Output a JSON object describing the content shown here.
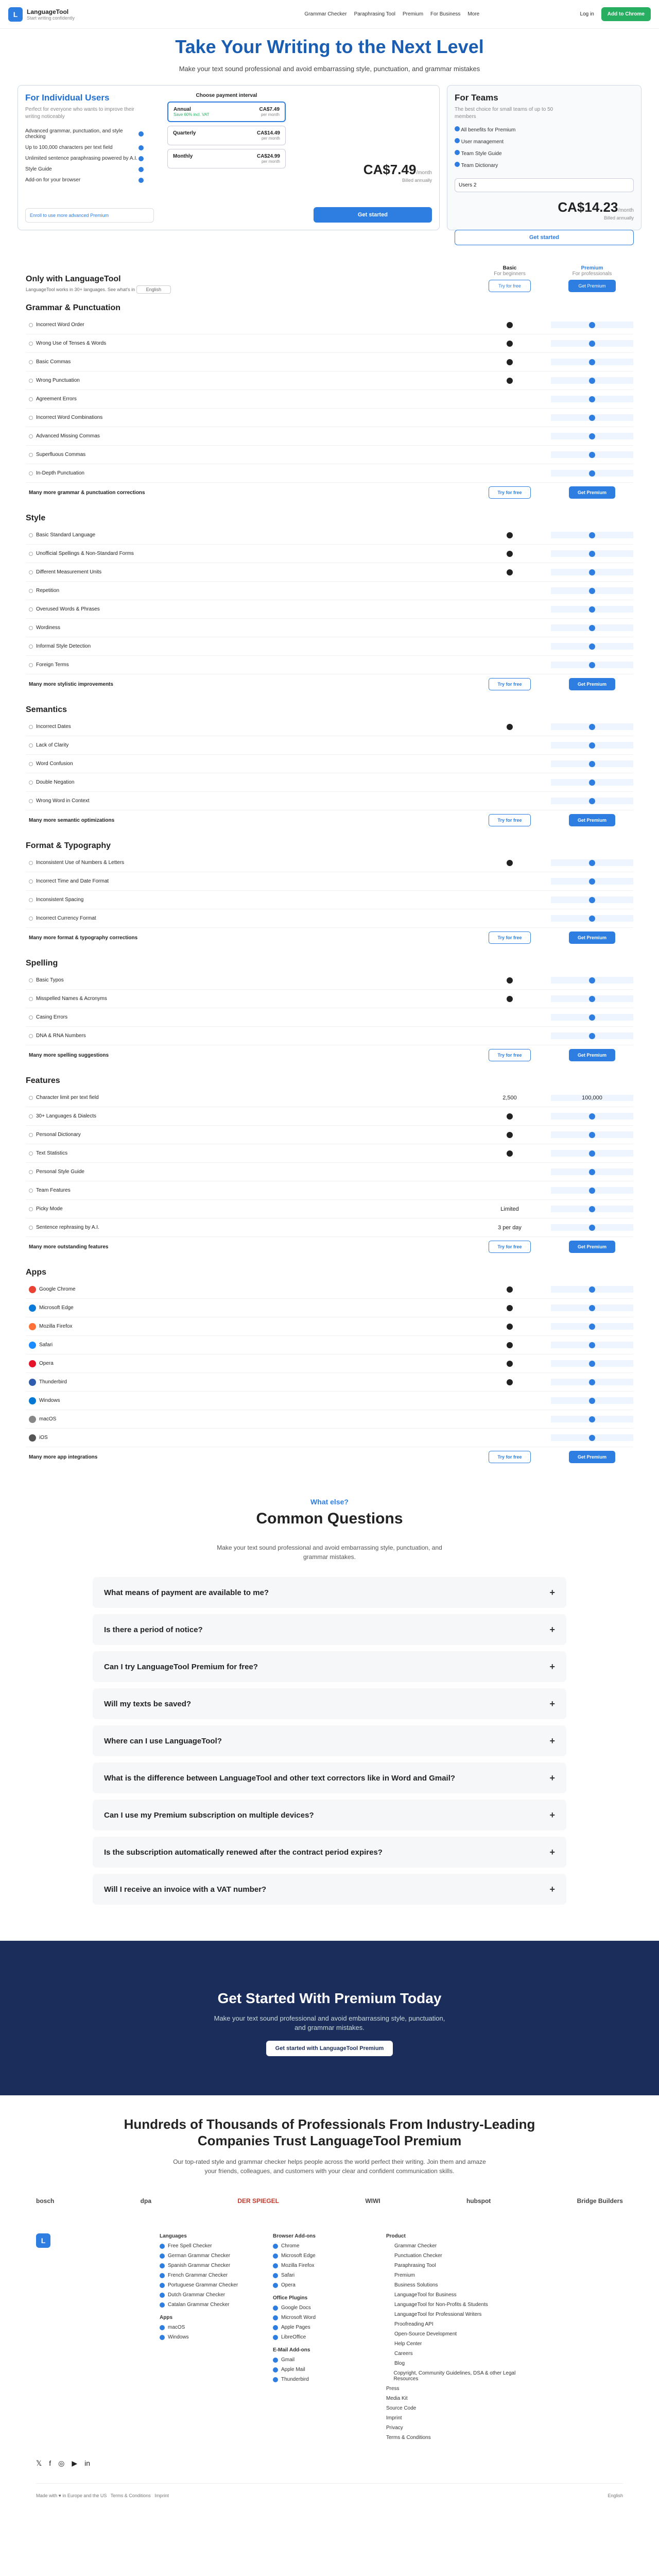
{
  "nav": {
    "brand": "LanguageTool",
    "tagline": "Start writing confidently",
    "links": [
      "Grammar Checker",
      "Paraphrasing Tool",
      "Premium",
      "For Business",
      "More"
    ],
    "login": "Log in",
    "cta": "Add to Chrome"
  },
  "hero": {
    "title": "Take Your Writing to the Next Level",
    "subtitle": "Make your text sound professional and avoid embarrassing style, punctuation, and grammar mistakes"
  },
  "individual": {
    "title": "For Individual Users",
    "desc": "Perfect for everyone who wants to improve their writing noticeably",
    "features": [
      "Advanced grammar, punctuation, and style checking",
      "Up to 100,000 characters per text field",
      "Unlimited sentence paraphrasing powered by A.I.",
      "Style Guide",
      "Add-on for your browser"
    ],
    "pay_head": "Choose payment interval",
    "options": [
      {
        "name": "Annual",
        "note": "Save 60% incl. VAT",
        "price": "CA$7.49",
        "unit": "per month"
      },
      {
        "name": "Quarterly",
        "note": "",
        "price": "CA$14.49",
        "unit": "per month"
      },
      {
        "name": "Monthly",
        "note": "",
        "price": "CA$24.99",
        "unit": "per month"
      }
    ],
    "price": "CA$7.49",
    "per": "/month",
    "billed": "Billed annually",
    "trial": "Enroll to use more advanced Premium",
    "button": "Get started"
  },
  "team": {
    "title": "For Teams",
    "desc": "The best choice for small teams of up to 50 members",
    "features": [
      "All benefits for Premium",
      "User management",
      "Team Style Guide",
      "Team Dictionary"
    ],
    "users": "Users 2",
    "price": "CA$14.23",
    "per": "/month",
    "note": "Billed annually",
    "button": "Get started"
  },
  "compare": {
    "title": "Only with LanguageTool",
    "lang_note": "LanguageTool works in 30+ languages. See what's in",
    "lang": "English",
    "basic": "Basic",
    "basic_sub": "For beginners",
    "premium": "Premium",
    "premium_sub": "For professionals",
    "try": "Try for free",
    "get": "Get Premium"
  },
  "sections": [
    {
      "title": "Grammar & Punctuation",
      "rows": [
        [
          "Incorrect Word Order",
          "b",
          "p"
        ],
        [
          "Wrong Use of Tenses & Words",
          "b",
          "p"
        ],
        [
          "Basic Commas",
          "b",
          "p"
        ],
        [
          "Wrong Punctuation",
          "b",
          "p"
        ],
        [
          "Agreement Errors",
          "",
          "p"
        ],
        [
          "Incorrect Word Combinations",
          "",
          "p"
        ],
        [
          "Advanced Missing Commas",
          "",
          "p"
        ],
        [
          "Superfluous Commas",
          "",
          "p"
        ],
        [
          "In-Depth Punctuation",
          "",
          "p"
        ]
      ],
      "more": "Many more grammar & punctuation corrections"
    },
    {
      "title": "Style",
      "rows": [
        [
          "Basic Standard Language",
          "b",
          "p"
        ],
        [
          "Unofficial Spellings & Non-Standard Forms",
          "b",
          "p"
        ],
        [
          "Different Measurement Units",
          "b",
          "p"
        ],
        [
          "Repetition",
          "",
          "p"
        ],
        [
          "Overused Words & Phrases",
          "",
          "p"
        ],
        [
          "Wordiness",
          "",
          "p"
        ],
        [
          "Informal Style Detection",
          "",
          "p"
        ],
        [
          "Foreign Terms",
          "",
          "p"
        ]
      ],
      "more": "Many more stylistic improvements"
    },
    {
      "title": "Semantics",
      "rows": [
        [
          "Incorrect Dates",
          "b",
          "p"
        ],
        [
          "Lack of Clarity",
          "",
          "p"
        ],
        [
          "Word Confusion",
          "",
          "p"
        ],
        [
          "Double Negation",
          "",
          "p"
        ],
        [
          "Wrong Word in Context",
          "",
          "p"
        ]
      ],
      "more": "Many more semantic optimizations"
    },
    {
      "title": "Format & Typography",
      "rows": [
        [
          "Inconsistent Use of Numbers & Letters",
          "b",
          "p"
        ],
        [
          "Incorrect Time and Date Format",
          "",
          "p"
        ],
        [
          "Inconsistent Spacing",
          "",
          "p"
        ],
        [
          "Incorrect Currency Format",
          "",
          "p"
        ]
      ],
      "more": "Many more format & typography corrections"
    },
    {
      "title": "Spelling",
      "rows": [
        [
          "Basic Typos",
          "b",
          "p"
        ],
        [
          "Misspelled Names & Acronyms",
          "b",
          "p"
        ],
        [
          "Casing Errors",
          "",
          "p"
        ],
        [
          "DNA & RNA Numbers",
          "",
          "p"
        ]
      ],
      "more": "Many more spelling suggestions"
    },
    {
      "title": "Features",
      "rows": [
        [
          "Character limit per text field",
          "2,500",
          "100,000"
        ],
        [
          "30+ Languages & Dialects",
          "b",
          "p"
        ],
        [
          "Personal Dictionary",
          "b",
          "p"
        ],
        [
          "Text Statistics",
          "b",
          "p"
        ],
        [
          "Personal Style Guide",
          "",
          "p"
        ],
        [
          "Team Features",
          "",
          "p"
        ],
        [
          "Picky Mode",
          "Limited",
          "p"
        ],
        [
          "Sentence rephrasing by A.I.",
          "3 per day",
          "p"
        ]
      ],
      "more": "Many more outstanding features"
    },
    {
      "title": "Apps",
      "rows": [
        [
          "Google Chrome",
          "b",
          "p"
        ],
        [
          "Microsoft Edge",
          "b",
          "p"
        ],
        [
          "Mozilla Firefox",
          "b",
          "p"
        ],
        [
          "Safari",
          "b",
          "p"
        ],
        [
          "Opera",
          "b",
          "p"
        ],
        [
          "Thunderbird",
          "b",
          "p"
        ],
        [
          "Windows",
          "",
          "p"
        ],
        [
          "macOS",
          "",
          "p"
        ],
        [
          "iOS",
          "",
          "p"
        ]
      ],
      "more": "Many more app integrations"
    }
  ],
  "faq": {
    "eyebrow": "What else?",
    "title": "Common Questions",
    "desc": "Make your text sound professional and avoid embarrassing style, punctuation, and grammar mistakes.",
    "questions": [
      "What means of payment are available to me?",
      "Is there a period of notice?",
      "Can I try LanguageTool Premium for free?",
      "Will my texts be saved?",
      "Where can I use LanguageTool?",
      "What is the difference between LanguageTool and other text correctors like in Word and Gmail?",
      "Can I use my Premium subscription on multiple devices?",
      "Is the subscription automatically renewed after the contract period expires?",
      "Will I receive an invoice with a VAT number?"
    ]
  },
  "promo": {
    "title": "Get Started With Premium Today",
    "desc": "Make your text sound professional and avoid embarrassing style, punctuation, and grammar mistakes.",
    "button": "Get started with LanguageTool Premium"
  },
  "trust": {
    "title": "Hundreds of Thousands of Professionals From Industry-Leading Companies Trust LanguageTool Premium",
    "desc": "Our top-rated style and grammar checker helps people across the world perfect their writing. Join them and amaze your friends, colleagues, and customers with your clear and confident communication skills.",
    "brands": [
      "bosch",
      "dpa",
      "DER SPIEGEL",
      "WIWI",
      "hubspot",
      "Bridge Builders"
    ]
  },
  "footer": {
    "c1h": "Languages",
    "c1": [
      "Free Spell Checker",
      "German Grammar Checker",
      "Spanish Grammar Checker",
      "French Grammar Checker",
      "Portuguese Grammar Checker",
      "Dutch Grammar Checker",
      "Catalan Grammar Checker"
    ],
    "c1b": "Apps",
    "c1bl": [
      "macOS",
      "Windows"
    ],
    "c2h": "Browser Add-ons",
    "c2": [
      "Chrome",
      "Microsoft Edge",
      "Mozilla Firefox",
      "Safari",
      "Opera"
    ],
    "c2b": "Office Plugins",
    "c2bl": [
      "Google Docs",
      "Microsoft Word",
      "Apple Pages",
      "LibreOffice"
    ],
    "c2c": "E-Mail Add-ons",
    "c2cl": [
      "Gmail",
      "Apple Mail",
      "Thunderbird"
    ],
    "c3h": "Product",
    "c3": [
      "Grammar Checker",
      "Punctuation Checker",
      "Paraphrasing Tool",
      "Premium",
      "Business Solutions",
      "LanguageTool for Business",
      "LanguageTool for Non-Profits & Students",
      "LanguageTool for Professional Writers",
      "Proofreading API",
      "Open-Source Development",
      "Help Center",
      "Careers",
      "Blog",
      "Copyright, Community Guidelines, DSA & other Legal Resources"
    ],
    "c3x": [
      "Press",
      "Media Kit",
      "Source Code",
      "Imprint",
      "Privacy",
      "Terms & Conditions"
    ],
    "copy": "Made with ♥ in Europe and the US",
    "copy2": "Terms & Conditions",
    "copy3": "Imprint",
    "lang": "English"
  }
}
